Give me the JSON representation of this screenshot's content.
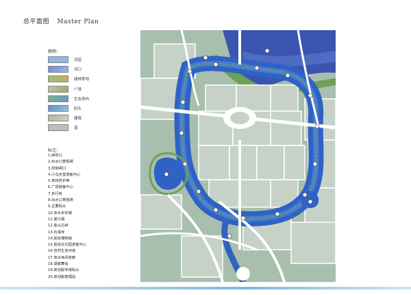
{
  "title": {
    "cn": "总平面图",
    "en": "Master Plan"
  },
  "legend": {
    "heading": "图例：",
    "items": [
      {
        "label": "河道",
        "color": "#8fb6e6"
      },
      {
        "label": "河口",
        "color": "#6a8fd1"
      },
      {
        "label": "疏林草地",
        "color": "#9bc07a"
      },
      {
        "label": "广场",
        "color": "#c8c2a4"
      },
      {
        "label": "生态岛屿",
        "color": "#86b28a"
      },
      {
        "label": "码头",
        "color": "#5d8ec8"
      },
      {
        "label": "建筑",
        "color": "#a7b9a6"
      },
      {
        "label": "道",
        "color": "#b8beb8"
      }
    ]
  },
  "index": {
    "heading": "标注：",
    "items": [
      "1.西坝口",
      "2.出水口景观闸",
      "3.控制闸口",
      "4.小鸟天堂游客中心",
      "5.老林防护带",
      "6.广场游客中心",
      "7.步行桥",
      "8.出水口景观闸",
      "9.主要码头",
      "10.亲水步石滩",
      "11.望江阁",
      "12.金山古树",
      "13.石潭寺",
      "14.民俗博物馆",
      "15.民俗文化园游客中心",
      "16.自然生态河道",
      "17.亲水休闲走廊",
      "18.湖底舞会",
      "19.皮划艇专用码头",
      "20.皮划艇管理站"
    ]
  },
  "map": {
    "background_color": "#a8bfae",
    "block_color": "#c6d2c7",
    "road_color": "#ffffff",
    "water_color": "#2f62c4",
    "outer_river_color": "#3a54b0",
    "green_bank_color": "#6fa05a",
    "marker_numbers": [
      "1",
      "2",
      "3",
      "4",
      "5",
      "6",
      "7",
      "8",
      "9",
      "10",
      "11",
      "12",
      "13",
      "14",
      "15",
      "16",
      "17",
      "18",
      "19",
      "20"
    ]
  }
}
